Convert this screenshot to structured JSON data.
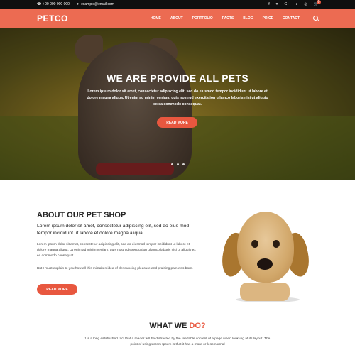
{
  "topbar": {
    "phone": "+00 000 000 000",
    "email": "example@email.com",
    "social": [
      "f",
      "♥",
      "G+",
      "●",
      "◎"
    ],
    "cart_count": "0"
  },
  "nav": {
    "logo": "PETCO",
    "items": [
      "HOME",
      "ABOUT",
      "PORTFOLIO",
      "FACTS",
      "BLOG",
      "PRICE",
      "CONTACT"
    ]
  },
  "hero": {
    "title": "WE ARE PROVIDE ALL PETS",
    "text": "Lorem ipsum dolor sit amet, consectetur adipiscing elit, sed do eiusmod tempor incididunt ut labore et dolore magna aliqua. Ut enim ad minim veniam, quis nostrud exercitation ullamco laboris nisi ut aliquip ex ea commodo consequat.",
    "button": "READ MORE"
  },
  "about": {
    "title": "ABOUT OUR PET SHOP",
    "lead": "Lorem ipsum dolor sit amet, consectetur adipiscing elit, sed do eius-mod tempor incididunt ut labore et dolore magna aliqua.",
    "p1": "Lorem ipsum dolor sit amet, consectetur adipiscing elit, sed do eiusmod tempor incididunt ut labore et dolore magna aliqua. Ut enim ad minim veniam, quis nostrud exercitation ullamco laboris nisi ut aliquip ex ea commodo consequat.",
    "p2": "But I must explain to you how all this mistaken idea of denouncing pleasure and praising pain was born.",
    "button": "READ MORE"
  },
  "what_we_do": {
    "title_main": "WHAT WE ",
    "title_accent": "DO?",
    "text": "t is a long established fact that a reader will be distracted by the readable content of a page when look-ing at its layout. The point of using Lorem Ipsum is that it has a more-or-less normal"
  },
  "colors": {
    "accent": "#e8573f",
    "nav": "#ec6b52",
    "topbar": "#0f0f0f"
  }
}
